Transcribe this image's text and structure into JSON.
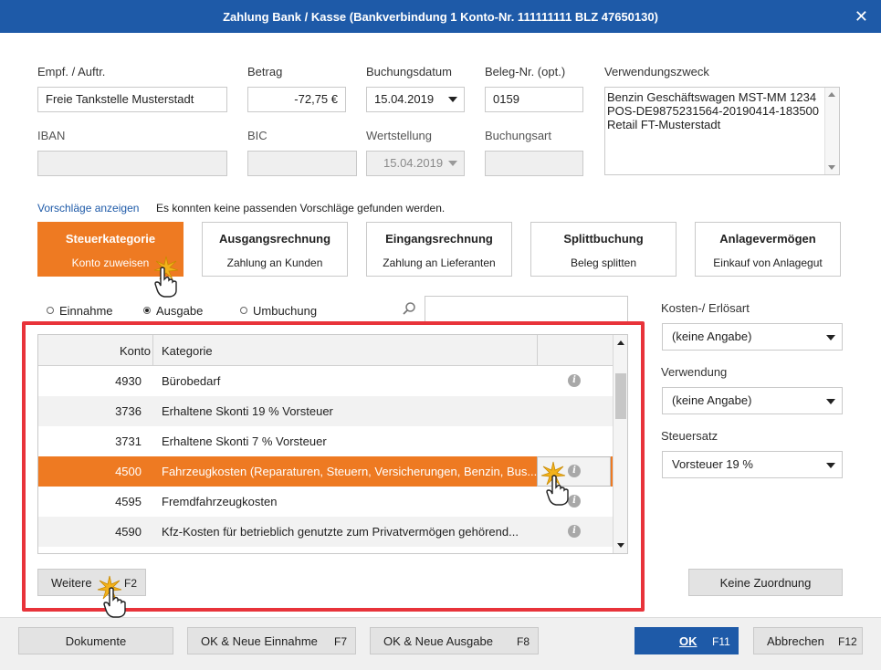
{
  "window": {
    "title": "Zahlung Bank / Kasse (Bankverbindung 1 Konto-Nr. 111111111  BLZ 47650130)",
    "close_label": "✕"
  },
  "form": {
    "empf_label": "Empf. / Auftr.",
    "empf_value": "Freie Tankstelle Musterstadt",
    "betrag_label": "Betrag",
    "betrag_value": "-72,75 €",
    "buchungsdatum_label": "Buchungsdatum",
    "buchungsdatum_value": "15.04.2019",
    "beleg_label": "Beleg-Nr. (opt.)",
    "beleg_value": "0159",
    "verwendungszweck_label": "Verwendungszweck",
    "verwendungszweck_lines": [
      "Benzin Geschäftswagen MST-MM 1234",
      "POS-DE9875231564-20190414-183500",
      "Retail FT-Musterstadt"
    ],
    "iban_label": "IBAN",
    "iban_value": "",
    "bic_label": "BIC",
    "bic_value": "",
    "wertstellung_label": "Wertstellung",
    "wertstellung_value": "15.04.2019",
    "buchungsart_label": "Buchungsart",
    "buchungsart_value": ""
  },
  "suggestions": {
    "link": "Vorschläge anzeigen",
    "hint": "Es konnten keine passenden Vorschläge gefunden werden."
  },
  "category_buttons": [
    {
      "title": "Steuerkategorie",
      "subtitle": "Konto zuweisen",
      "active": true
    },
    {
      "title": "Ausgangsrechnung",
      "subtitle": "Zahlung an Kunden",
      "active": false
    },
    {
      "title": "Eingangsrechnung",
      "subtitle": "Zahlung an Lieferanten",
      "active": false
    },
    {
      "title": "Splittbuchung",
      "subtitle": "Beleg splitten",
      "active": false
    },
    {
      "title": "Anlagevermögen",
      "subtitle": "Einkauf von Anlagegut",
      "active": false
    }
  ],
  "radios": {
    "einnahme": "Einnahme",
    "ausgabe": "Ausgabe",
    "umbuchung": "Umbuchung",
    "selected": "ausgabe"
  },
  "table": {
    "col_konto": "Konto",
    "col_kategorie": "Kategorie",
    "rows": [
      {
        "konto": "4930",
        "kategorie": "Bürobedarf"
      },
      {
        "konto": "3736",
        "kategorie": "Erhaltene Skonti 19 % Vorsteuer"
      },
      {
        "konto": "3731",
        "kategorie": "Erhaltene Skonti 7 % Vorsteuer"
      },
      {
        "konto": "4500",
        "kategorie": "Fahrzeugkosten (Reparaturen, Steuern, Versicherungen, Benzin, Bus..."
      },
      {
        "konto": "4595",
        "kategorie": "Fremdfahrzeugkosten"
      },
      {
        "konto": "4590",
        "kategorie": "Kfz-Kosten für betrieblich genutzte zum Privatvermögen gehörend..."
      }
    ],
    "selected_index": 3
  },
  "side": {
    "kosten_label": "Kosten-/ Erlösart",
    "kosten_value": "(keine Angabe)",
    "verwendung_label": "Verwendung",
    "verwendung_value": "(keine Angabe)",
    "steuersatz_label": "Steuersatz",
    "steuersatz_value": "Vorsteuer 19 %",
    "keine_zuordnung": "Keine Zuordnung"
  },
  "weitere": {
    "label": "Weitere",
    "key": "F2"
  },
  "footer": {
    "dokumente": "Dokumente",
    "neue_einnahme": "OK & Neue Einnahme",
    "neue_einnahme_key": "F7",
    "neue_ausgabe": "OK & Neue Ausgabe",
    "neue_ausgabe_key": "F8",
    "ok": "OK",
    "ok_key": "F11",
    "abbrechen": "Abbrechen",
    "abbrechen_key": "F12"
  },
  "colors": {
    "accent_orange": "#ee7a22",
    "title_blue": "#1e5aa8",
    "highlight_red": "#e8333a"
  }
}
